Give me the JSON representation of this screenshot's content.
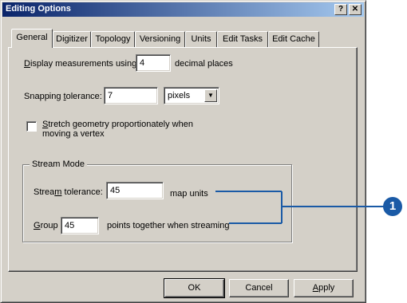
{
  "window": {
    "title": "Editing Options",
    "help_label": "?",
    "close_label": "✕"
  },
  "tabs": [
    {
      "label": "General",
      "active": true
    },
    {
      "label": "Digitizer"
    },
    {
      "label": "Topology"
    },
    {
      "label": "Versioning"
    },
    {
      "label": "Units"
    },
    {
      "label": "Edit Tasks"
    },
    {
      "label": "Edit Cache"
    }
  ],
  "general": {
    "display_prefix": "isplay measurements using",
    "display_mnemonic": "D",
    "display_value": "4",
    "display_suffix": "decimal places",
    "snap_label_prefix": "Snapping ",
    "snap_label_mnemonic": "t",
    "snap_label_suffix": "olerance:",
    "snap_value": "7",
    "snap_unit": "pixels",
    "stretch_line1_mnemonic": "S",
    "stretch_line1_rest": "tretch geometry proportionately when",
    "stretch_line2": "moving a vertex",
    "stretch_checked": false
  },
  "stream_mode": {
    "title": "Stream Mode",
    "tolerance_prefix": "Strea",
    "tolerance_mnemonic": "m",
    "tolerance_suffix": " tolerance:",
    "tolerance_value": "45",
    "tolerance_unit": "map units",
    "group_mnemonic": "G",
    "group_rest": "roup",
    "group_value": "45",
    "group_suffix": "points together when streaming"
  },
  "buttons": {
    "ok": "OK",
    "cancel": "Cancel",
    "apply_mnemonic": "A",
    "apply_rest": "pply"
  },
  "callout": {
    "number": "1",
    "color": "#1a5aa6"
  }
}
